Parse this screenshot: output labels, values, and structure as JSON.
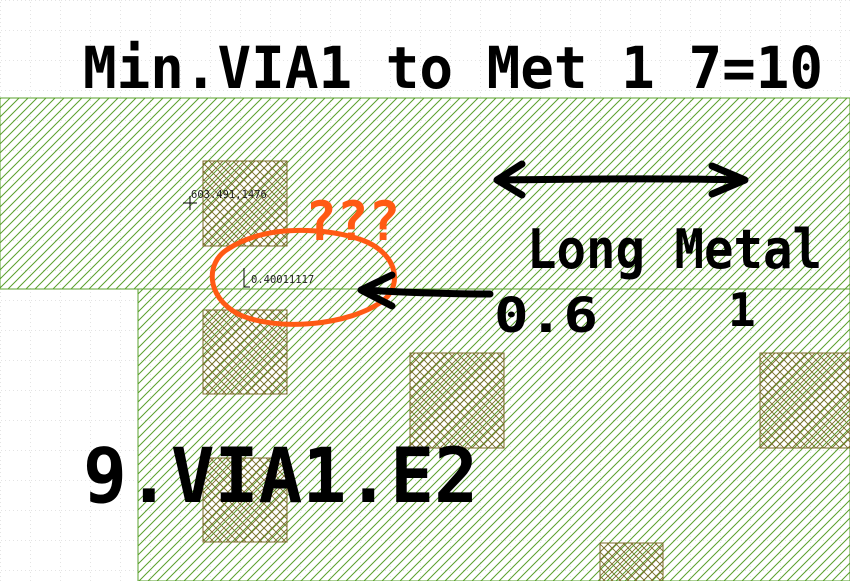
{
  "canvas": {
    "background_color": "#ffffff",
    "grid_color": "#c8c8c8"
  },
  "layers": {
    "metal1": {
      "color": "#5aa02c",
      "pattern": "diagonal-hatch"
    },
    "via1": {
      "color": "#7a6a2a",
      "pattern": "cross-hatch"
    }
  },
  "readouts": {
    "cursor_coordinates": "603.491,1476",
    "spacing_measurement": "0.40011117"
  },
  "annotations": {
    "color_ink": "#000000",
    "color_highlight": "#ff5a14",
    "title": "Min.VIA1 to Met 1 7=10",
    "long_metal_label": "Long Metal",
    "long_metal_number": "1",
    "spacing_value": "0.6",
    "question_marks": "???",
    "rule_name": "9.VIA1.E2"
  }
}
